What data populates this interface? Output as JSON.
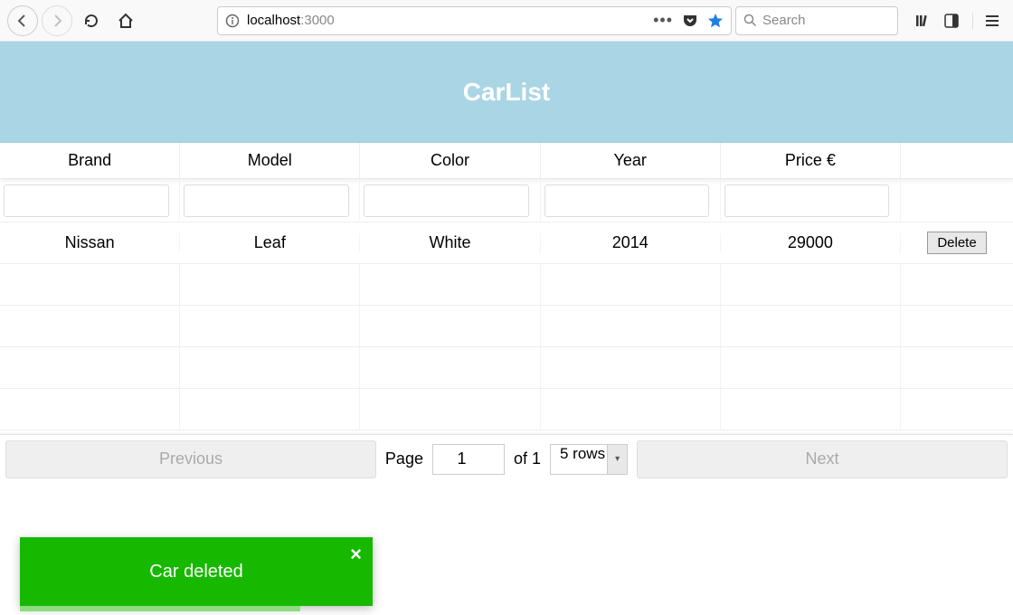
{
  "browser": {
    "url_host": "localhost",
    "url_port": ":3000",
    "search_placeholder": "Search"
  },
  "header": {
    "title": "CarList"
  },
  "table": {
    "columns": [
      "Brand",
      "Model",
      "Color",
      "Year",
      "Price €"
    ],
    "rows": [
      {
        "brand": "Nissan",
        "model": "Leaf",
        "color": "White",
        "year": "2014",
        "price": "29000"
      }
    ],
    "delete_label": "Delete"
  },
  "pagination": {
    "previous_label": "Previous",
    "next_label": "Next",
    "page_label": "Page",
    "of_label": "of 1",
    "page_value": "1",
    "rows_label": "5 rows"
  },
  "toast": {
    "message": "Car deleted"
  }
}
